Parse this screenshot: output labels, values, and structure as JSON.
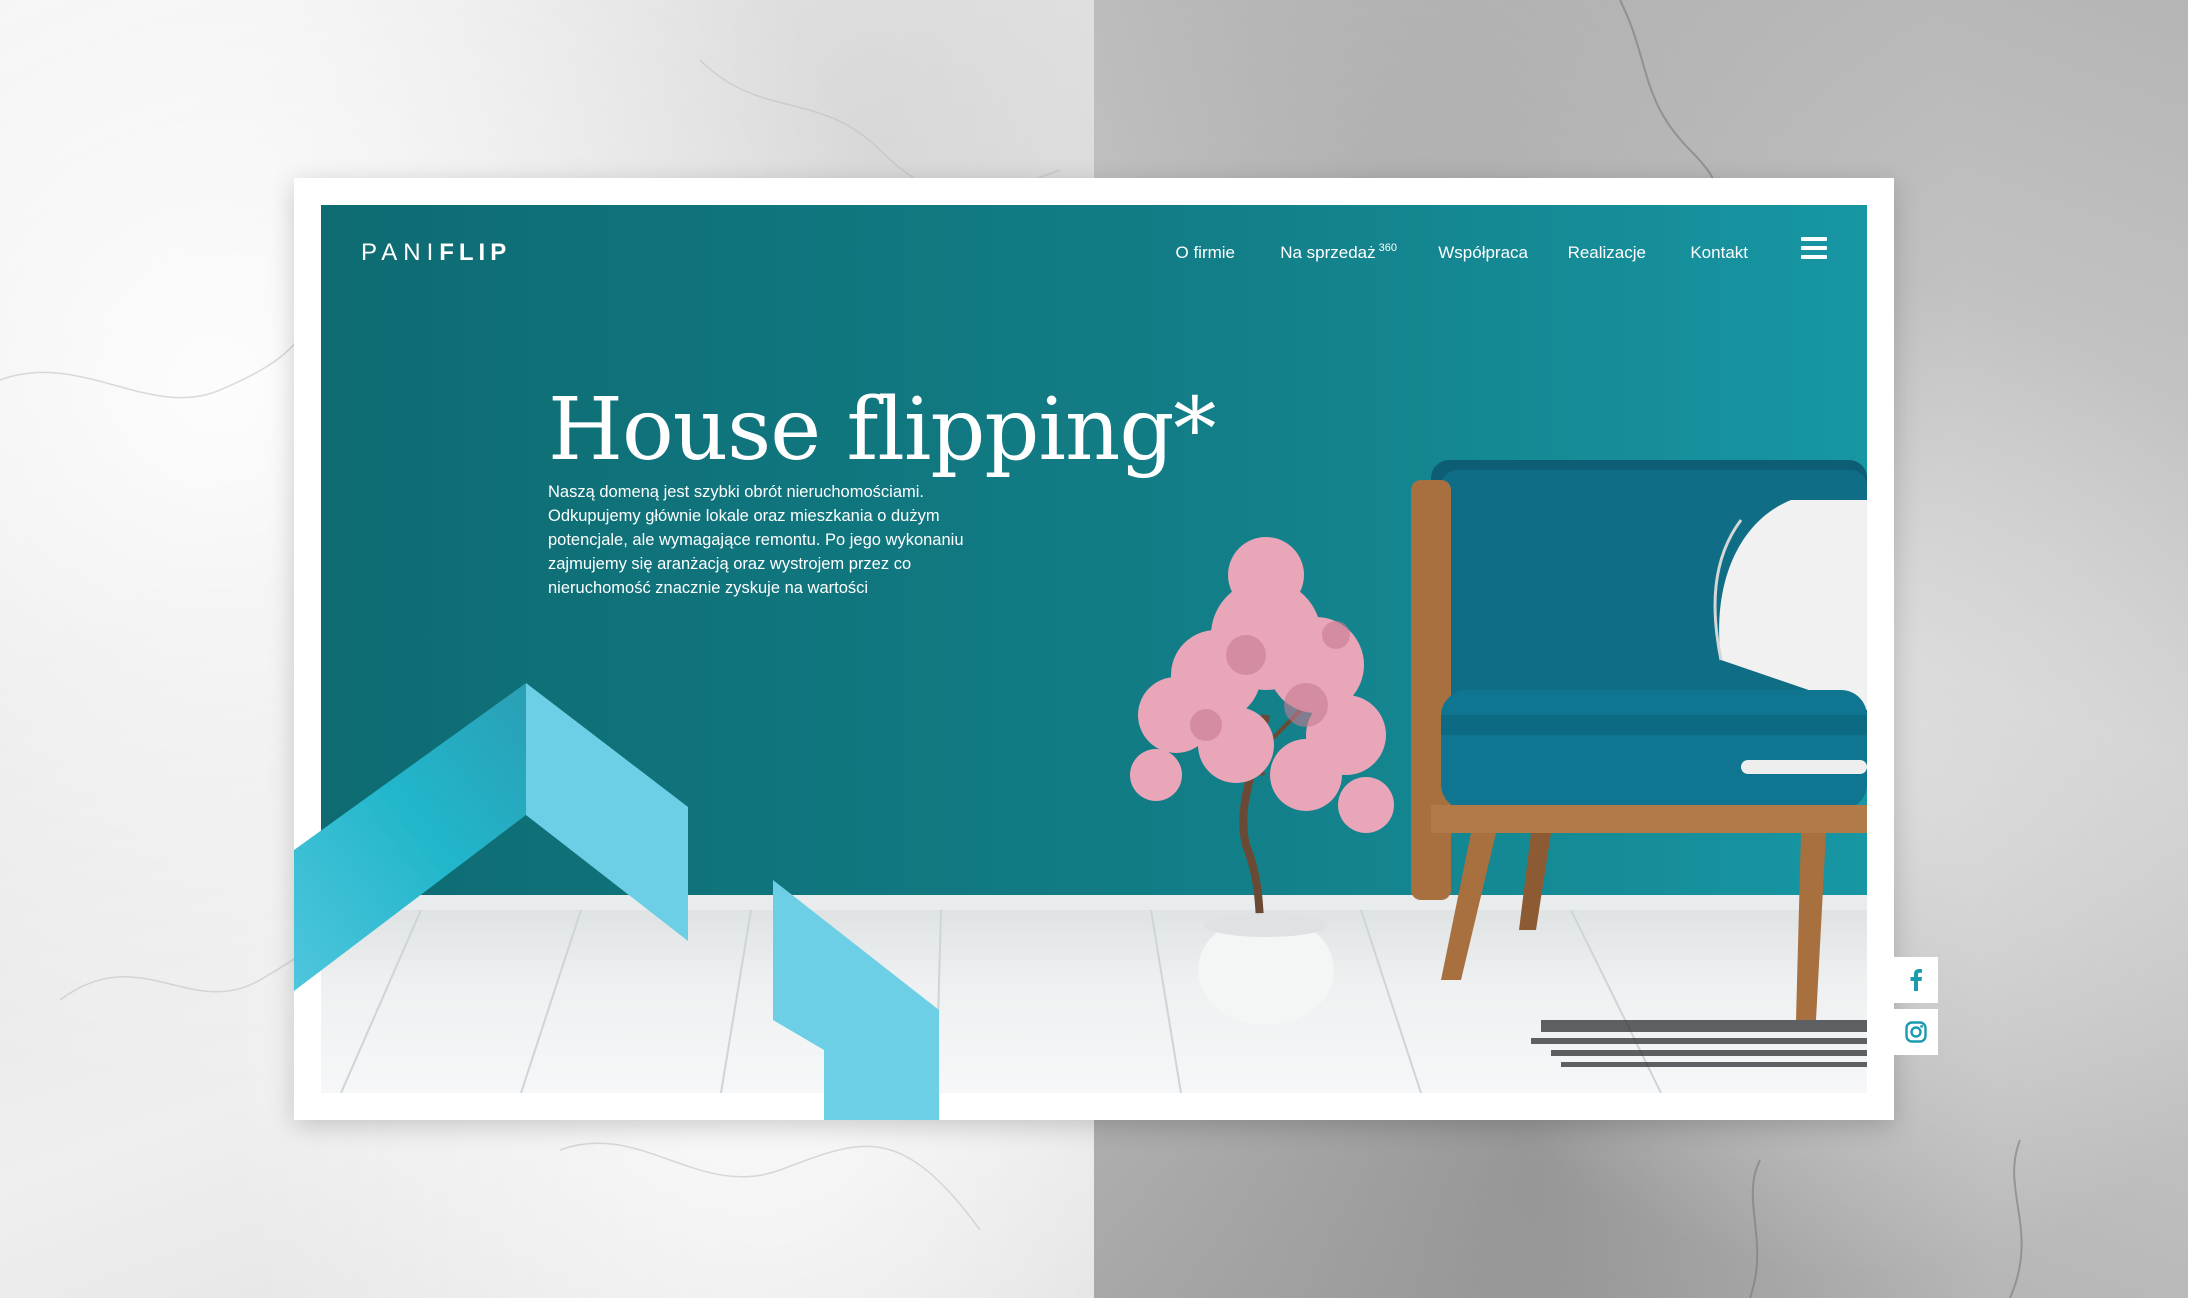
{
  "logo": {
    "part1": "PANI",
    "part2": "FLIP"
  },
  "nav": {
    "items": [
      {
        "label": "O firmie"
      },
      {
        "label": "Na sprzedaż",
        "sup": "360"
      },
      {
        "label": "Współpraca"
      },
      {
        "label": "Realizacje"
      },
      {
        "label": "Kontakt"
      }
    ],
    "menu_icon": "hamburger-icon"
  },
  "hero": {
    "title": "House flipping*",
    "description": "Naszą domeną jest szybki obrót nieruchomościami. Odkupujemy głównie lokale oraz mieszkania o dużym potencjale, ale wymagające remontu. Po jego wykonaniu zajmujemy się aranżacją oraz wystrojem przez co nieruchomość znacznie zyskuje na wartości"
  },
  "social": [
    {
      "icon": "facebook-icon"
    },
    {
      "icon": "instagram-icon"
    }
  ],
  "colors": {
    "teal_dark": "#0e6b72",
    "teal_light": "#1796a3",
    "accent_blue": "#6ecfe6",
    "accent_mid": "#25b7cc",
    "social_icon": "#1a9bb0"
  }
}
